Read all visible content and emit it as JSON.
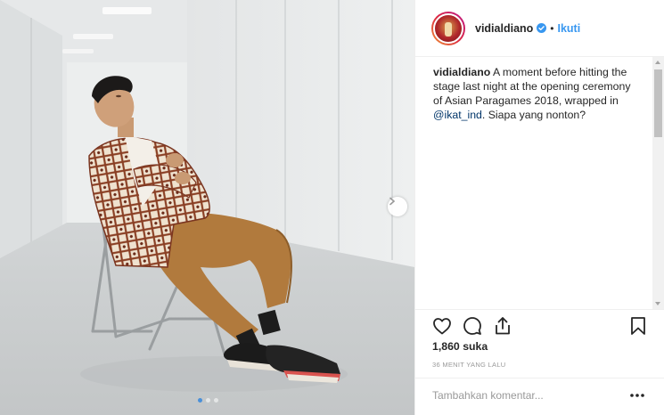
{
  "post": {
    "username": "vidialdiano",
    "separator": "•",
    "follow_label": "Ikuti",
    "caption": {
      "author": "vidialdiano",
      "text_before": " A moment before hitting the stage last night at the opening ceremony of Asian Paragames 2018, wrapped in ",
      "mention": "@ikat_ind",
      "text_after": ". Siapa yang nonton?"
    },
    "likes": "1,860 suka",
    "timestamp": "36 MENIT YANG LALU",
    "comment_placeholder": "Tambahkan komentar...",
    "carousel": {
      "total": 3,
      "active": 1
    }
  },
  "icons": {
    "verified": "verified-badge-icon",
    "like": "heart-icon",
    "comment": "comment-icon",
    "share": "share-icon",
    "save": "bookmark-icon",
    "more": "more-options-icon",
    "next": "chevron-right-icon"
  },
  "colors": {
    "link_blue": "#3897f0",
    "mention": "#003569",
    "active_dot": "#4a90d9"
  }
}
